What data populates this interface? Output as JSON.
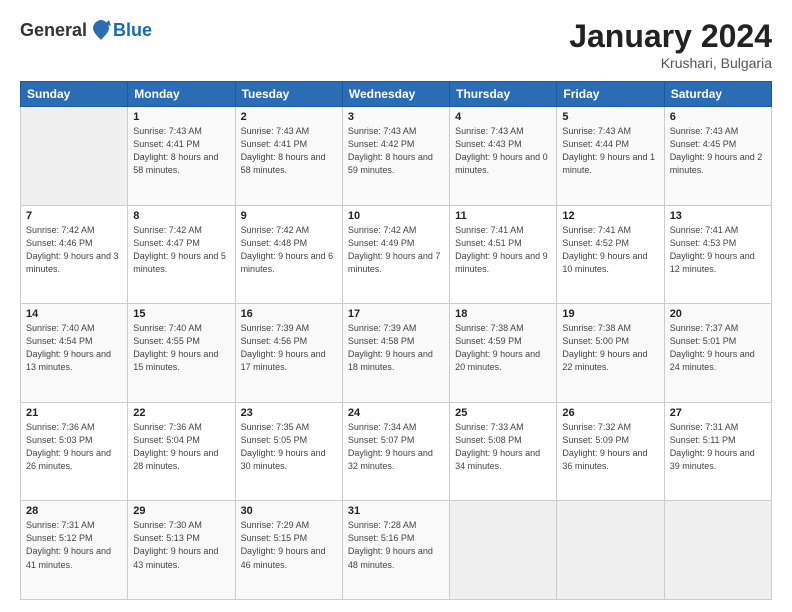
{
  "logo": {
    "general": "General",
    "blue": "Blue"
  },
  "title": "January 2024",
  "location": "Krushari, Bulgaria",
  "weekdays": [
    "Sunday",
    "Monday",
    "Tuesday",
    "Wednesday",
    "Thursday",
    "Friday",
    "Saturday"
  ],
  "weeks": [
    [
      {
        "day": "",
        "empty": true
      },
      {
        "day": "1",
        "sunrise": "Sunrise: 7:43 AM",
        "sunset": "Sunset: 4:41 PM",
        "daylight": "Daylight: 8 hours and 58 minutes."
      },
      {
        "day": "2",
        "sunrise": "Sunrise: 7:43 AM",
        "sunset": "Sunset: 4:41 PM",
        "daylight": "Daylight: 8 hours and 58 minutes."
      },
      {
        "day": "3",
        "sunrise": "Sunrise: 7:43 AM",
        "sunset": "Sunset: 4:42 PM",
        "daylight": "Daylight: 8 hours and 59 minutes."
      },
      {
        "day": "4",
        "sunrise": "Sunrise: 7:43 AM",
        "sunset": "Sunset: 4:43 PM",
        "daylight": "Daylight: 9 hours and 0 minutes."
      },
      {
        "day": "5",
        "sunrise": "Sunrise: 7:43 AM",
        "sunset": "Sunset: 4:44 PM",
        "daylight": "Daylight: 9 hours and 1 minute."
      },
      {
        "day": "6",
        "sunrise": "Sunrise: 7:43 AM",
        "sunset": "Sunset: 4:45 PM",
        "daylight": "Daylight: 9 hours and 2 minutes."
      }
    ],
    [
      {
        "day": "7",
        "sunrise": "Sunrise: 7:42 AM",
        "sunset": "Sunset: 4:46 PM",
        "daylight": "Daylight: 9 hours and 3 minutes."
      },
      {
        "day": "8",
        "sunrise": "Sunrise: 7:42 AM",
        "sunset": "Sunset: 4:47 PM",
        "daylight": "Daylight: 9 hours and 5 minutes."
      },
      {
        "day": "9",
        "sunrise": "Sunrise: 7:42 AM",
        "sunset": "Sunset: 4:48 PM",
        "daylight": "Daylight: 9 hours and 6 minutes."
      },
      {
        "day": "10",
        "sunrise": "Sunrise: 7:42 AM",
        "sunset": "Sunset: 4:49 PM",
        "daylight": "Daylight: 9 hours and 7 minutes."
      },
      {
        "day": "11",
        "sunrise": "Sunrise: 7:41 AM",
        "sunset": "Sunset: 4:51 PM",
        "daylight": "Daylight: 9 hours and 9 minutes."
      },
      {
        "day": "12",
        "sunrise": "Sunrise: 7:41 AM",
        "sunset": "Sunset: 4:52 PM",
        "daylight": "Daylight: 9 hours and 10 minutes."
      },
      {
        "day": "13",
        "sunrise": "Sunrise: 7:41 AM",
        "sunset": "Sunset: 4:53 PM",
        "daylight": "Daylight: 9 hours and 12 minutes."
      }
    ],
    [
      {
        "day": "14",
        "sunrise": "Sunrise: 7:40 AM",
        "sunset": "Sunset: 4:54 PM",
        "daylight": "Daylight: 9 hours and 13 minutes."
      },
      {
        "day": "15",
        "sunrise": "Sunrise: 7:40 AM",
        "sunset": "Sunset: 4:55 PM",
        "daylight": "Daylight: 9 hours and 15 minutes."
      },
      {
        "day": "16",
        "sunrise": "Sunrise: 7:39 AM",
        "sunset": "Sunset: 4:56 PM",
        "daylight": "Daylight: 9 hours and 17 minutes."
      },
      {
        "day": "17",
        "sunrise": "Sunrise: 7:39 AM",
        "sunset": "Sunset: 4:58 PM",
        "daylight": "Daylight: 9 hours and 18 minutes."
      },
      {
        "day": "18",
        "sunrise": "Sunrise: 7:38 AM",
        "sunset": "Sunset: 4:59 PM",
        "daylight": "Daylight: 9 hours and 20 minutes."
      },
      {
        "day": "19",
        "sunrise": "Sunrise: 7:38 AM",
        "sunset": "Sunset: 5:00 PM",
        "daylight": "Daylight: 9 hours and 22 minutes."
      },
      {
        "day": "20",
        "sunrise": "Sunrise: 7:37 AM",
        "sunset": "Sunset: 5:01 PM",
        "daylight": "Daylight: 9 hours and 24 minutes."
      }
    ],
    [
      {
        "day": "21",
        "sunrise": "Sunrise: 7:36 AM",
        "sunset": "Sunset: 5:03 PM",
        "daylight": "Daylight: 9 hours and 26 minutes."
      },
      {
        "day": "22",
        "sunrise": "Sunrise: 7:36 AM",
        "sunset": "Sunset: 5:04 PM",
        "daylight": "Daylight: 9 hours and 28 minutes."
      },
      {
        "day": "23",
        "sunrise": "Sunrise: 7:35 AM",
        "sunset": "Sunset: 5:05 PM",
        "daylight": "Daylight: 9 hours and 30 minutes."
      },
      {
        "day": "24",
        "sunrise": "Sunrise: 7:34 AM",
        "sunset": "Sunset: 5:07 PM",
        "daylight": "Daylight: 9 hours and 32 minutes."
      },
      {
        "day": "25",
        "sunrise": "Sunrise: 7:33 AM",
        "sunset": "Sunset: 5:08 PM",
        "daylight": "Daylight: 9 hours and 34 minutes."
      },
      {
        "day": "26",
        "sunrise": "Sunrise: 7:32 AM",
        "sunset": "Sunset: 5:09 PM",
        "daylight": "Daylight: 9 hours and 36 minutes."
      },
      {
        "day": "27",
        "sunrise": "Sunrise: 7:31 AM",
        "sunset": "Sunset: 5:11 PM",
        "daylight": "Daylight: 9 hours and 39 minutes."
      }
    ],
    [
      {
        "day": "28",
        "sunrise": "Sunrise: 7:31 AM",
        "sunset": "Sunset: 5:12 PM",
        "daylight": "Daylight: 9 hours and 41 minutes."
      },
      {
        "day": "29",
        "sunrise": "Sunrise: 7:30 AM",
        "sunset": "Sunset: 5:13 PM",
        "daylight": "Daylight: 9 hours and 43 minutes."
      },
      {
        "day": "30",
        "sunrise": "Sunrise: 7:29 AM",
        "sunset": "Sunset: 5:15 PM",
        "daylight": "Daylight: 9 hours and 46 minutes."
      },
      {
        "day": "31",
        "sunrise": "Sunrise: 7:28 AM",
        "sunset": "Sunset: 5:16 PM",
        "daylight": "Daylight: 9 hours and 48 minutes."
      },
      {
        "day": "",
        "empty": true
      },
      {
        "day": "",
        "empty": true
      },
      {
        "day": "",
        "empty": true
      }
    ]
  ]
}
